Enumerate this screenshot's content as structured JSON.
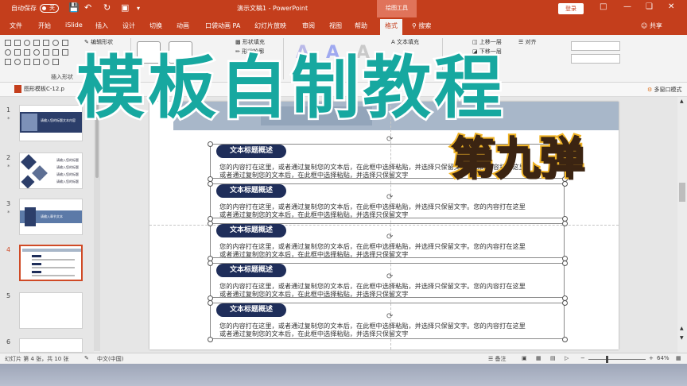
{
  "titlebar": {
    "autosave_label": "自动保存",
    "autosave_state": "关",
    "doc_title": "演示文稿1 - PowerPoint",
    "context_tool": "绘图工具",
    "login": "登录",
    "quick_access_icons": [
      "save-icon",
      "undo-icon",
      "redo-icon",
      "present-icon"
    ],
    "accent_color": "#c43e1c"
  },
  "tabs": [
    {
      "label": "文件"
    },
    {
      "label": "开始"
    },
    {
      "label": "iSlide"
    },
    {
      "label": "插入"
    },
    {
      "label": "设计"
    },
    {
      "label": "切换"
    },
    {
      "label": "动画"
    },
    {
      "label": "口袋动画 PA"
    },
    {
      "label": "幻灯片放映"
    },
    {
      "label": "审阅"
    },
    {
      "label": "视图"
    },
    {
      "label": "帮助"
    },
    {
      "label": "格式"
    }
  ],
  "active_tab": "格式",
  "search": {
    "label": "搜索"
  },
  "share": {
    "label": "共享"
  },
  "ribbon": {
    "edit_shape": "编辑形状",
    "insert_shape_group": "插入形状",
    "shape_fill": "形状填充",
    "shape_outline": "形状轮廓",
    "shape_effect": "效果",
    "text_fill": "文本填充",
    "bring_forward": "上移一层",
    "send_backward": "下移一层",
    "align": "对齐"
  },
  "docstrip": {
    "file_tab": "图形模板C-12.p",
    "multi_window": "多窗口模式"
  },
  "thumbnails": [
    {
      "num": "1",
      "star": "*",
      "caption": "请输入您的标题文本内容"
    },
    {
      "num": "2",
      "star": "*",
      "captions": [
        "请输入您的标题",
        "请输入您的标题",
        "请输入您的标题",
        "请输入您的标题"
      ]
    },
    {
      "num": "3",
      "star": "*",
      "caption": "请输入章节文本"
    },
    {
      "num": "4",
      "star": "",
      "selected": true
    },
    {
      "num": "5",
      "star": ""
    },
    {
      "num": "6",
      "star": ""
    }
  ],
  "slide": {
    "items": [
      {
        "title": "文本标题概述",
        "line1": "您的内容打在这里，或者通过复制您的文本后，在此框中选择粘贴，并选择只保留文字。您的内容打在这里",
        "line2": "或者通过复制您的文本后，在此框中选择粘贴，并选择只保留文字"
      },
      {
        "title": "文本标题概述",
        "line1": "您的内容打在这里，或者通过复制您的文本后，在此框中选择粘贴，并选择只保留文字。您的内容打在这里",
        "line2": "或者通过复制您的文本后，在此框中选择粘贴，并选择只保留文字"
      },
      {
        "title": "文本标题概述",
        "line1": "您的内容打在这里，或者通过复制您的文本后，在此框中选择粘贴，并选择只保留文字。您的内容打在这里",
        "line2": "或者通过复制您的文本后，在此框中选择粘贴，并选择只保留文字"
      },
      {
        "title": "文本标题概述",
        "line1": "您的内容打在这里，或者通过复制您的文本后，在此框中选择粘贴，并选择只保留文字。您的内容打在这里",
        "line2": "或者通过复制您的文本后，在此框中选择粘贴，并选择只保留文字"
      },
      {
        "title": "文本标题概述",
        "line1": "您的内容打在这里，或者通过复制您的文本后，在此框中选择粘贴，并选择只保留文字。您的内容打在这里",
        "line2": "或者通过复制您的文本后，在此框中选择粘贴，并选择只保留文字"
      }
    ],
    "pill_color": "#1f2e5a"
  },
  "status": {
    "slide_info": "幻灯片 第 4 张，共 10 张",
    "language": "中文(中国)",
    "notes": "备注",
    "zoom": "64%"
  },
  "overlay": {
    "title": "模板自制教程",
    "subtitle": "第九弹",
    "title_color": "#17a8a0",
    "subtitle_color": "#f1b426"
  }
}
